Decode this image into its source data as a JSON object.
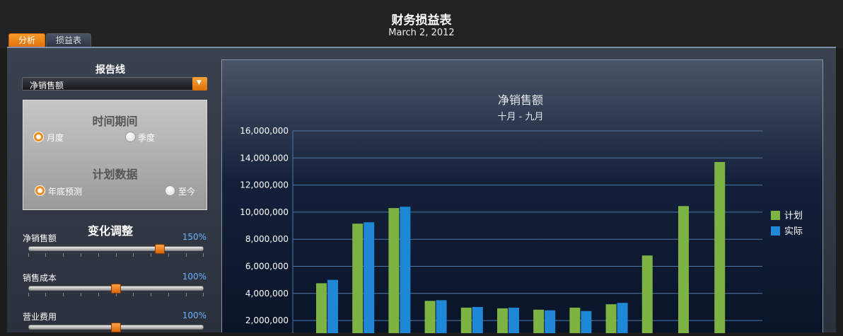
{
  "header": {
    "title": "财务损益表",
    "date": "March 2, 2012"
  },
  "tabs": [
    {
      "label": "分析"
    },
    {
      "label": "损益表"
    }
  ],
  "left": {
    "report_line_title": "报告线",
    "dropdown_value": "净销售额",
    "time_period": {
      "title": "时间期间",
      "options": [
        "月度",
        "季度"
      ]
    },
    "plan_data": {
      "title": "计划数据",
      "options": [
        "年底预测",
        "至今"
      ]
    },
    "adjustments": {
      "title": "变化调整",
      "sliders": [
        {
          "label": "净销售额",
          "value": "150%"
        },
        {
          "label": "销售成本",
          "value": "100%"
        },
        {
          "label": "营业费用",
          "value": "100%"
        }
      ]
    }
  },
  "colors": {
    "plan": "#7cb342",
    "actual": "#1e88d6",
    "accent": "#f08a1c"
  },
  "chart_data": {
    "type": "bar",
    "title": "净销售额",
    "subtitle": "十月 - 九月",
    "y_ticks": [
      "16,000,000",
      "14,000,000",
      "12,000,000",
      "10,000,000",
      "8,000,000",
      "6,000,000",
      "4,000,000",
      "2,000,000"
    ],
    "ylim": [
      0,
      16000000
    ],
    "legend_position": "right",
    "series": [
      {
        "name": "计划",
        "values": [
          4750000,
          9150000,
          10300000,
          3450000,
          2950000,
          2900000,
          2800000,
          2950000,
          3200000,
          6800000,
          10450000,
          13700000
        ]
      },
      {
        "name": "实际",
        "values": [
          5000000,
          9250000,
          10400000,
          3500000,
          3000000,
          2950000,
          2750000,
          2700000,
          3300000,
          null,
          null,
          null
        ]
      }
    ]
  }
}
